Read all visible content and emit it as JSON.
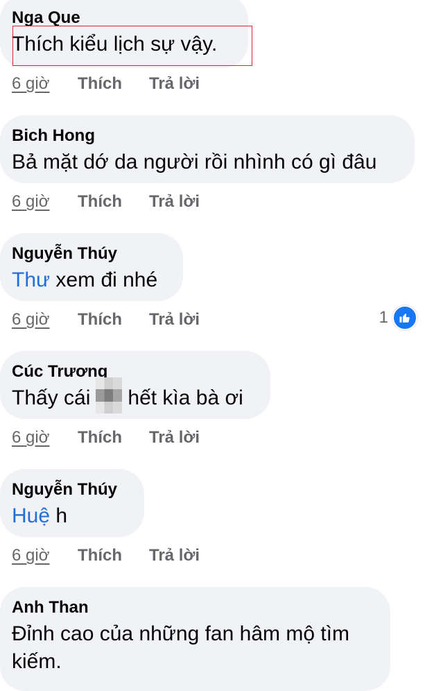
{
  "comments": [
    {
      "author": "Nga Que",
      "text": "Thích kiểu lịch sự vậy.",
      "time": "6 giờ",
      "like": "Thích",
      "reply": "Trả lời"
    },
    {
      "author": "Bich Hong",
      "text": "Bả mặt dớ da người rồi nhình có gì đâu",
      "time": "6 giờ",
      "like": "Thích",
      "reply": "Trả lời"
    },
    {
      "author": "Nguyễn Thúy",
      "mention": "Thư",
      "text": " xem đi nhé",
      "time": "6 giờ",
      "like": "Thích",
      "reply": "Trả lời",
      "reaction_count": "1"
    },
    {
      "author": "Cúc Trương",
      "text_before": "Thấy cái",
      "text_after": "hết kìa bà ơi",
      "time": "6 giờ",
      "like": "Thích",
      "reply": "Trả lời"
    },
    {
      "author": "Nguyễn Thúy",
      "mention": "Huệ",
      "text": " h",
      "time": "6 giờ",
      "like": "Thích",
      "reply": "Trả lời"
    },
    {
      "author": "Anh Than",
      "text_line1": "Đỉnh cao của những fan hâm mộ tìm",
      "text_line2": "kiếm."
    }
  ],
  "icons": {
    "reaction": "like-icon",
    "redaction": "censored-pixelated-block"
  },
  "colors": {
    "bubble": "#f0f2f5",
    "mention": "#216fdb",
    "meta": "#65676b",
    "like_blue": "#1877f2",
    "highlight_border": "#d42a2a"
  }
}
